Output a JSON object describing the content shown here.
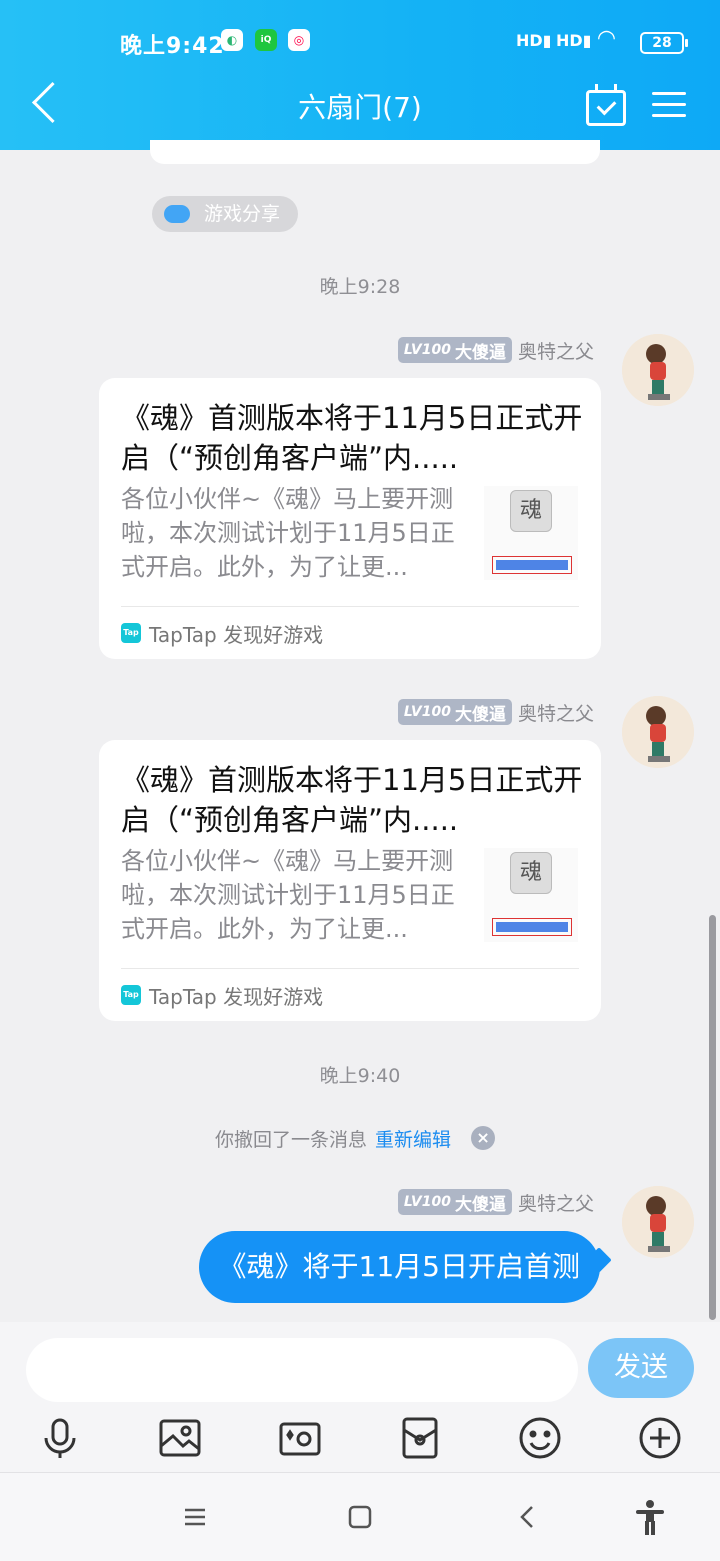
{
  "status_bar": {
    "time": "晚上9:42",
    "signal_1": "HD",
    "signal_2": "HD",
    "battery": "28"
  },
  "header": {
    "title": "六扇门(7)"
  },
  "chat": {
    "game_share": "游戏分享",
    "time_1": "晚上9:28",
    "time_2": "晚上9:40",
    "messages": [
      {
        "level": "LV100",
        "title_badge": "大傻逼",
        "sender": "奥特之父",
        "card_title": "《魂》首测版本将于11月5日正式开启（“预创角客户端”内.....",
        "card_desc": "各位小伙伴~《魂》马上要开测啦，本次测试计划于11月5日正式开启。此外，为了让更...",
        "source": "TapTap 发现好游戏"
      },
      {
        "level": "LV100",
        "title_badge": "大傻逼",
        "sender": "奥特之父",
        "card_title": "《魂》首测版本将于11月5日正式开启（“预创角客户端”内.....",
        "card_desc": "各位小伙伴~《魂》马上要开测啦，本次测试计划于11月5日正式开启。此外，为了让更...",
        "source": "TapTap 发现好游戏"
      }
    ],
    "recall_text": "你撤回了一条消息",
    "recall_edit": "重新编辑",
    "last_message": {
      "level": "LV100",
      "title_badge": "大傻逼",
      "sender": "奥特之父",
      "text": "《魂》将于11月5日开启首测"
    }
  },
  "input": {
    "send": "发送"
  },
  "colors": {
    "header": "#1ab6f6",
    "bubble": "#1592f6",
    "send": "#7cc5f7"
  }
}
